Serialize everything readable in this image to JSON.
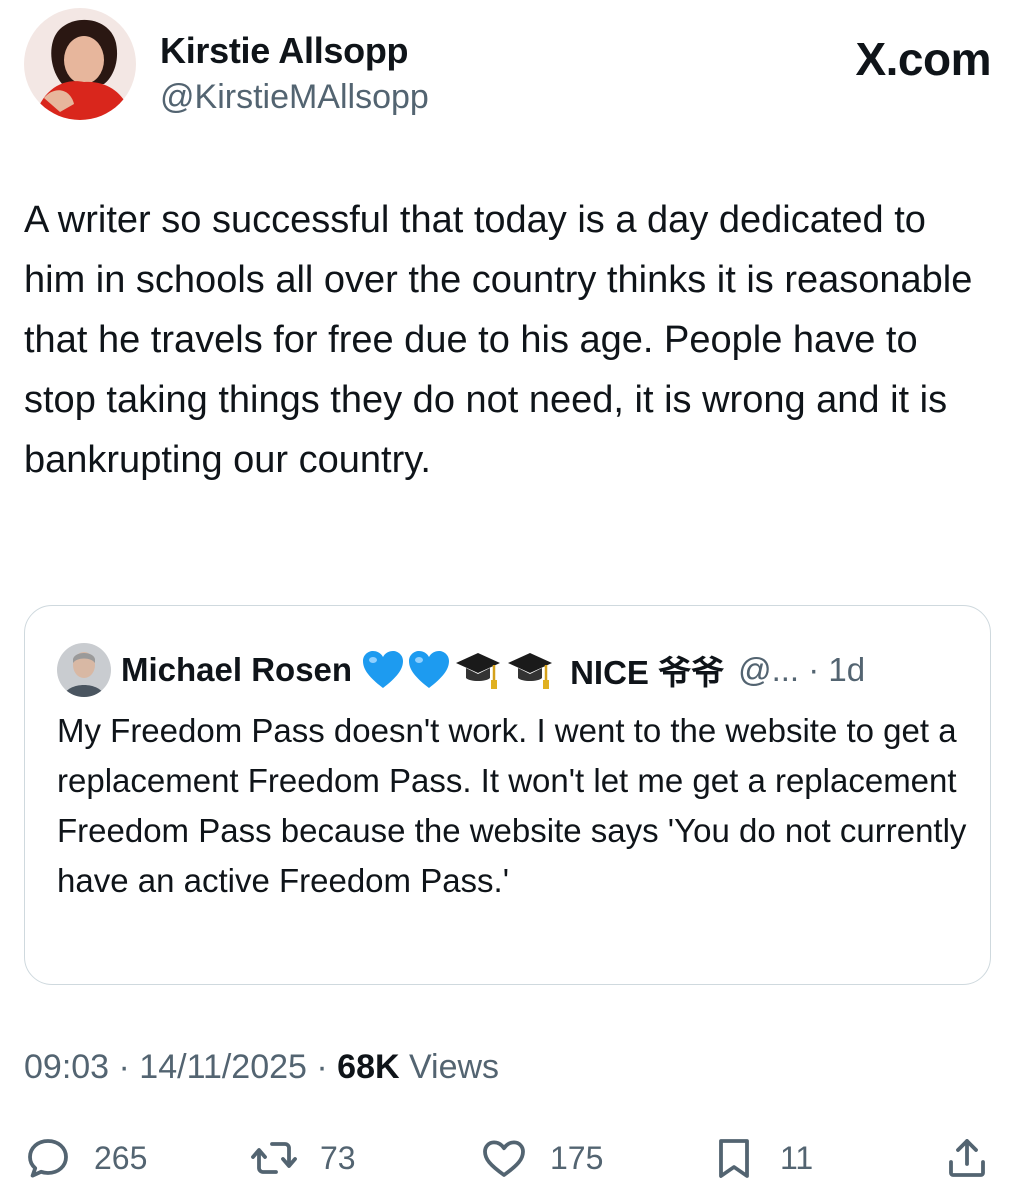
{
  "author": {
    "name": "Kirstie Allsopp",
    "handle": "@KirstieMAllsopp"
  },
  "brand": "X.com",
  "post": {
    "text": "A writer so successful that today is a day dedicated to him in schools all over the country thinks it is reasonable that he travels for free due to his age. People have to stop taking things they do not need, it is wrong and it is bankrupting our country."
  },
  "quoted": {
    "name": "Michael Rosen",
    "badges": [
      "blue-heart-icon",
      "blue-heart-icon",
      "graduation-cap-icon",
      "graduation-cap-icon"
    ],
    "name_suffix": "NICE 爷爷",
    "handle_time": "@... · 1d",
    "text": "My Freedom Pass doesn't work. I went to the website to get a replacement Freedom Pass. It won't let me get a replacement Freedom Pass because the website says 'You do not currently have an active Freedom Pass.'"
  },
  "meta": {
    "time_date": "09:03 · 14/11/2025 · ",
    "views_count": "68K",
    "views_label": " Views"
  },
  "actions": {
    "replies": "265",
    "reposts": "73",
    "likes": "175",
    "bookmarks": "11"
  },
  "colors": {
    "text": "#0f1419",
    "secondary": "#536471",
    "border": "#cfd9de",
    "heart_blue": "#1d9bf0"
  }
}
